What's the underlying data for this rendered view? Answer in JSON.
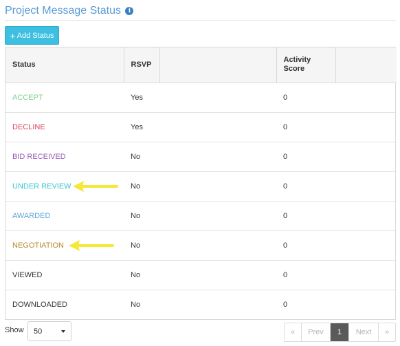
{
  "page": {
    "title": "Project Message Status",
    "info_icon": "i"
  },
  "toolbar": {
    "add_icon": "+",
    "add_label": "Add Status"
  },
  "table": {
    "headers": [
      "Status",
      "RSVP",
      "",
      "Activity Score",
      ""
    ],
    "rows": [
      {
        "status": "ACCEPT",
        "color": "#7ccf8e",
        "rsvp": "Yes",
        "score": "0"
      },
      {
        "status": "DECLINE",
        "color": "#d9445a",
        "rsvp": "Yes",
        "score": "0"
      },
      {
        "status": "BID RECEIVED",
        "color": "#9b59b6",
        "rsvp": "No",
        "score": "0"
      },
      {
        "status": "UNDER REVIEW",
        "color": "#3ec5d0",
        "rsvp": "No",
        "score": "0"
      },
      {
        "status": "AWARDED",
        "color": "#5aa7d8",
        "rsvp": "No",
        "score": "0"
      },
      {
        "status": "NEGOTIATION",
        "color": "#b8862b",
        "rsvp": "No",
        "score": "0"
      },
      {
        "status": "VIEWED",
        "color": "#333333",
        "rsvp": "No",
        "score": "0"
      },
      {
        "status": "DOWNLOADED",
        "color": "#333333",
        "rsvp": "No",
        "score": "0"
      }
    ]
  },
  "annotations": {
    "arrow_color": "#f5e83a",
    "arrow_icon": "yellow-arrow-icon"
  },
  "footer": {
    "show_label": "Show",
    "page_size": "50",
    "pagination": {
      "first": "«",
      "prev": "Prev",
      "current": "1",
      "next": "Next",
      "last": "»"
    }
  }
}
